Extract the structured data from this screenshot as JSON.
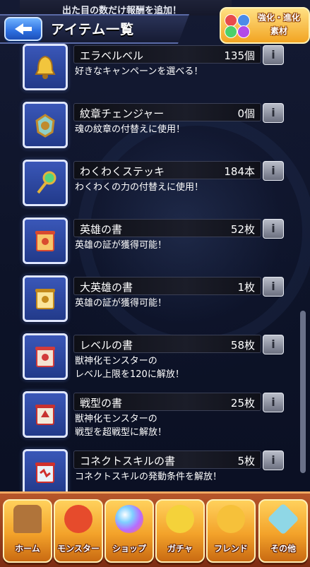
{
  "header": {
    "partial_text": "出た目の数だけ報酬を追加！",
    "title": "アイテム一覧",
    "back_icon": "back-arrow-icon",
    "evolve_label_1": "強化・進化",
    "evolve_label_2": "素材"
  },
  "items": [
    {
      "name": "エラベルベル",
      "count": "135個",
      "desc": "好きなキャンペーンを選べる！",
      "icon": "bell-icon",
      "colors": [
        "#f2c53d",
        "#a7701c"
      ]
    },
    {
      "name": "紋章チェンジャー",
      "count": "0個",
      "desc": "魂の紋章の付替えに使用！",
      "icon": "emblem-changer-icon",
      "colors": [
        "#8fd0c8",
        "#c08b2c"
      ]
    },
    {
      "name": "わくわくステッキ",
      "count": "184本",
      "desc": "わくわくの力の付替えに使用！",
      "icon": "wand-icon",
      "colors": [
        "#55d67d",
        "#e2b43c"
      ]
    },
    {
      "name": "英雄の書",
      "count": "52枚",
      "desc": "英雄の証が獲得可能！",
      "icon": "hero-scroll-icon",
      "colors": [
        "#f7c66b",
        "#d94a2f"
      ]
    },
    {
      "name": "大英雄の書",
      "count": "1枚",
      "desc": "英雄の証が獲得可能！",
      "icon": "great-hero-scroll-icon",
      "colors": [
        "#fbe59a",
        "#c48a1c"
      ]
    },
    {
      "name": "レベルの書",
      "count": "58枚",
      "desc": "獣神化モンスターの\nレベル上限を120に解放！",
      "icon": "level-scroll-icon",
      "colors": [
        "#f4e3d2",
        "#d23b3b"
      ]
    },
    {
      "name": "戦型の書",
      "count": "25枚",
      "desc": "獣神化モンスターの\n戦型を超戦型に解放！",
      "icon": "battle-type-scroll-icon",
      "colors": [
        "#f2ead9",
        "#c7312f"
      ]
    },
    {
      "name": "コネクトスキルの書",
      "count": "5枚",
      "desc": "コネクトスキルの発動条件を解放！",
      "icon": "connect-skill-scroll-icon",
      "colors": [
        "#eaf2f8",
        "#d0302c"
      ]
    }
  ],
  "info_label": "i",
  "nav": [
    {
      "label": "ホーム",
      "icon": "home-icon",
      "color": "#b0743a"
    },
    {
      "label": "モンスター",
      "icon": "monster-icon",
      "color": "#e64b2c"
    },
    {
      "label": "ショップ",
      "icon": "shop-orb-icon",
      "color": "#7fd0ff"
    },
    {
      "label": "ガチャ",
      "icon": "gacha-icon",
      "color": "#f4d23a"
    },
    {
      "label": "フレンド",
      "icon": "friend-icon",
      "color": "#f6c13a"
    },
    {
      "label": "その他",
      "icon": "other-icon",
      "color": "#8fd7e6"
    }
  ]
}
